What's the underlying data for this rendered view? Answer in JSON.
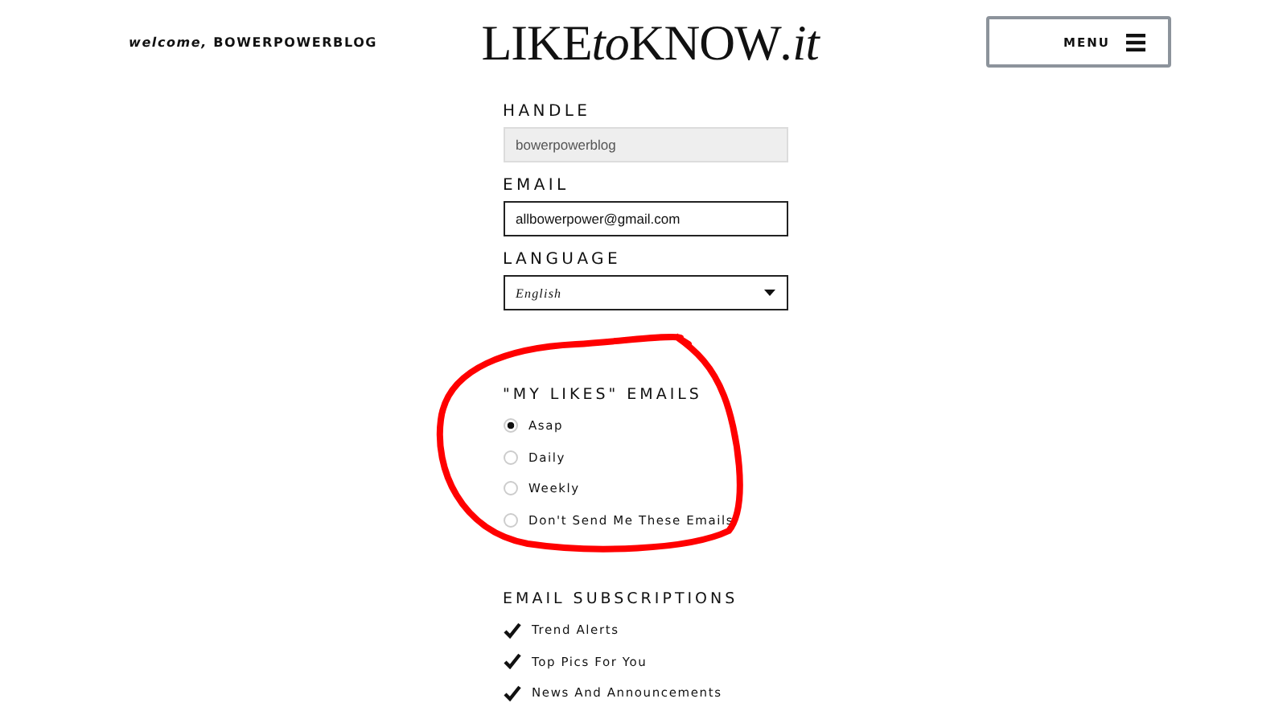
{
  "header": {
    "welcome": "*welcome,* **BOWERPOWERBLOG**",
    "logo": [
      {
        "text": "LIKE",
        "italic": false
      },
      {
        "text": "to",
        "italic": true
      },
      {
        "text": "KNOW",
        "italic": false
      },
      {
        "text": ".it",
        "italic": true
      }
    ],
    "menu": {
      "label": "MENU"
    }
  },
  "fields": [
    {
      "label": "HANDLE",
      "value": "bowerpowerblog",
      "kind": "text",
      "disabled": true
    },
    {
      "label": "EMAIL",
      "value": "allbowerpower@gmail.com",
      "kind": "text",
      "disabled": false
    },
    {
      "label": "LANGUAGE",
      "value": "English",
      "kind": "select",
      "disabled": false
    }
  ],
  "likes_emails": {
    "title": "\"MY LIKES\" EMAILS",
    "options": [
      {
        "label": "Asap",
        "selected": true
      },
      {
        "label": "Daily",
        "selected": false
      },
      {
        "label": "Weekly",
        "selected": false
      },
      {
        "label": "Don't Send Me These Emails",
        "selected": false
      }
    ]
  },
  "subscriptions": {
    "title": "EMAIL SUBSCRIPTIONS",
    "items": [
      {
        "label": "Trend Alerts",
        "checked": true
      },
      {
        "label": "Top Pics For You",
        "checked": true
      },
      {
        "label": "News And Announcements",
        "checked": true
      }
    ]
  },
  "annotation": {
    "kind": "freehand-circle"
  }
}
